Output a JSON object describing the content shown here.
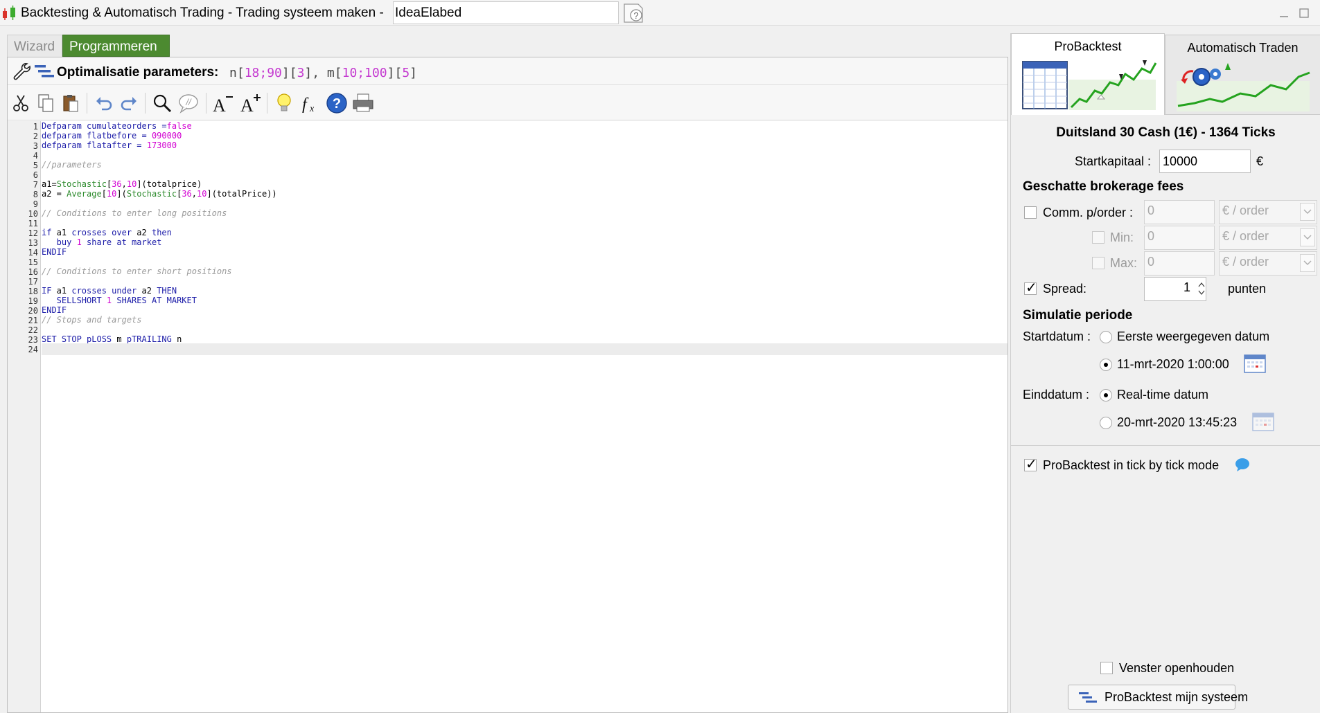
{
  "window": {
    "title": "Backtesting & Automatisch Trading - Trading systeem maken -",
    "system_name": "IdeaElabed"
  },
  "tabs": {
    "wizard": "Wizard",
    "programmeren": "Programmeren"
  },
  "optimization": {
    "label": "Optimalisatie parameters:",
    "params": [
      {
        "name": "n",
        "range": "18;90",
        "step": "3"
      },
      {
        "name": "m",
        "range": "10;100",
        "step": "5"
      }
    ]
  },
  "toolbar_icons": [
    "cut-icon",
    "copy-icon",
    "paste-icon",
    "undo-icon",
    "redo-icon",
    "search-icon",
    "comment-icon",
    "font-decrease-icon",
    "font-increase-icon",
    "lightbulb-icon",
    "function-icon",
    "help-icon",
    "print-icon"
  ],
  "code": [
    {
      "n": "1",
      "html": "<span class='k'>Defparam cumulateorders =</span><span class='n'>false</span>"
    },
    {
      "n": "2",
      "html": "<span class='k'>defparam flatbefore = </span><span class='n'>090000</span>"
    },
    {
      "n": "3",
      "html": "<span class='k'>defparam flatafter = </span><span class='n'>173000</span>"
    },
    {
      "n": "4",
      "html": ""
    },
    {
      "n": "5",
      "html": "<span class='c'>//parameters</span>"
    },
    {
      "n": "6",
      "html": ""
    },
    {
      "n": "7",
      "html": "<span class='t'>a1=</span><span class='f'>Stochastic</span><span class='t'>[</span><span class='n'>36</span><span class='t'>,</span><span class='n'>10</span><span class='t'>](totalprice)</span>"
    },
    {
      "n": "8",
      "html": "<span class='t'>a2 = </span><span class='f'>Average</span><span class='t'>[</span><span class='n'>10</span><span class='t'>](</span><span class='f'>Stochastic</span><span class='t'>[</span><span class='n'>36</span><span class='t'>,</span><span class='n'>10</span><span class='t'>](totalPrice))</span>"
    },
    {
      "n": "9",
      "html": ""
    },
    {
      "n": "10",
      "html": "<span class='c'>// Conditions to enter long positions</span>"
    },
    {
      "n": "11",
      "html": ""
    },
    {
      "n": "12",
      "html": "<span class='k'>if</span><span class='t'> a1 </span><span class='k'>crosses over</span><span class='t'> a2 </span><span class='k'>then</span>"
    },
    {
      "n": "13",
      "html": "<span class='k'>   buy </span><span class='n'>1</span><span class='k'> share at market</span>"
    },
    {
      "n": "14",
      "html": "<span class='k'>ENDIF</span>"
    },
    {
      "n": "15",
      "html": ""
    },
    {
      "n": "16",
      "html": "<span class='c'>// Conditions to enter short positions</span>"
    },
    {
      "n": "17",
      "html": ""
    },
    {
      "n": "18",
      "html": "<span class='k'>IF</span><span class='t'> a1 </span><span class='k'>crosses under</span><span class='t'> a2 </span><span class='k'>THEN</span>"
    },
    {
      "n": "19",
      "html": "<span class='k'>   SELLSHORT </span><span class='n'>1</span><span class='k'> SHARES AT MARKET</span>"
    },
    {
      "n": "20",
      "html": "<span class='k'>ENDIF</span>"
    },
    {
      "n": "21",
      "html": "<span class='c'>// Stops and targets</span>"
    },
    {
      "n": "22",
      "html": ""
    },
    {
      "n": "23",
      "html": "<span class='k'>SET STOP pLOSS</span><span class='t'> m </span><span class='k'>pTRAILING</span><span class='t'> n</span>"
    },
    {
      "n": "24",
      "html": ""
    }
  ],
  "right": {
    "tab_probacktest": "ProBacktest",
    "tab_auto": "Automatisch Traden",
    "instrument": "Duitsland 30 Cash (1€) - 1364 Ticks",
    "startkapitaal_label": "Startkapitaal :",
    "startkapitaal_value": "10000",
    "currency": "€",
    "fees_header": "Geschatte brokerage fees",
    "comm_label": "Comm. p/order :",
    "comm_value": "0",
    "per_order": "€ / order",
    "min_label": "Min:",
    "min_value": "0",
    "max_label": "Max:",
    "max_value": "0",
    "spread_label": "Spread:",
    "spread_value": "1",
    "spread_unit": "punten",
    "sim_header": "Simulatie periode",
    "start_label": "Startdatum :",
    "start_opt1": "Eerste weergegeven datum",
    "start_opt2": "11-mrt-2020 1:00:00",
    "end_label": "Einddatum :",
    "end_opt1": "Real-time datum",
    "end_opt2": "20-mrt-2020 13:45:23",
    "tick_mode": "ProBacktest in tick by tick mode",
    "keep_open": "Venster openhouden",
    "run_button": "ProBacktest mijn systeem"
  }
}
